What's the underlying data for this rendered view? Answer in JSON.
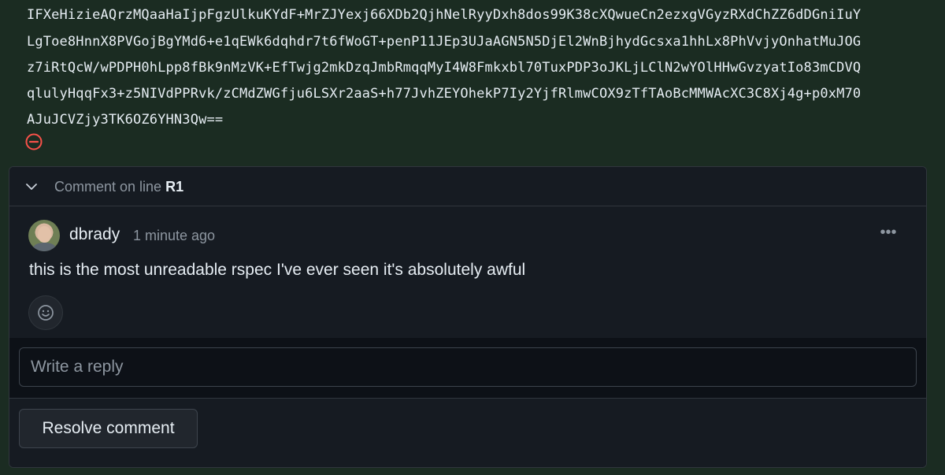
{
  "diff": {
    "lines": [
      "IFXeHizieAQrzMQaaHaIjpFgzUlkuKYdF+MrZJYexj66XDb2QjhNelRyyDxh8dos99K38cXQwueCn2ezxgVGyzRXdChZZ6dDGniIuY",
      "LgToe8HnnX8PVGojBgYMd6+e1qEWk6dqhdr7t6fWoGT+penP11JEp3UJaAGN5N5DjEl2WnBjhydGcsxa1hhLx8PhVvjyOnhatMuJOG",
      "z7iRtQcW/wPDPH0hLpp8fBk9nMzVK+EfTwjg2mkDzqJmbRmqqMyI4W8Fmkxbl70TuxPDP3oJKLjLClN2wYOlHHwGvzyatIo83mCDVQ",
      "qlulyHqqFx3+z5NIVdPPRvk/zCMdZWGfju6LSXr2aaS+h77JvhZEYOhekP7Iy2YjfRlmwCOX9zTfTAoBcMMWAcXC3C8Xj4g+p0xM70",
      "AJuJCVZjy3TK6OZ6YHN3Qw=="
    ],
    "line_status_icon": "minus-circle-icon",
    "accent_color": "#f85149"
  },
  "thread": {
    "header_prefix": "Comment on line",
    "header_line": "R1",
    "collapse_icon": "chevron-down-icon"
  },
  "comment": {
    "author": "dbrady",
    "time": "1 minute ago",
    "text": "this is the most unreadable rspec I've ever seen it's absolutely awful",
    "more_label": "•••",
    "reaction_icon": "smiley-icon"
  },
  "reply": {
    "placeholder": "Write a reply"
  },
  "footer": {
    "resolve_label": "Resolve comment"
  }
}
